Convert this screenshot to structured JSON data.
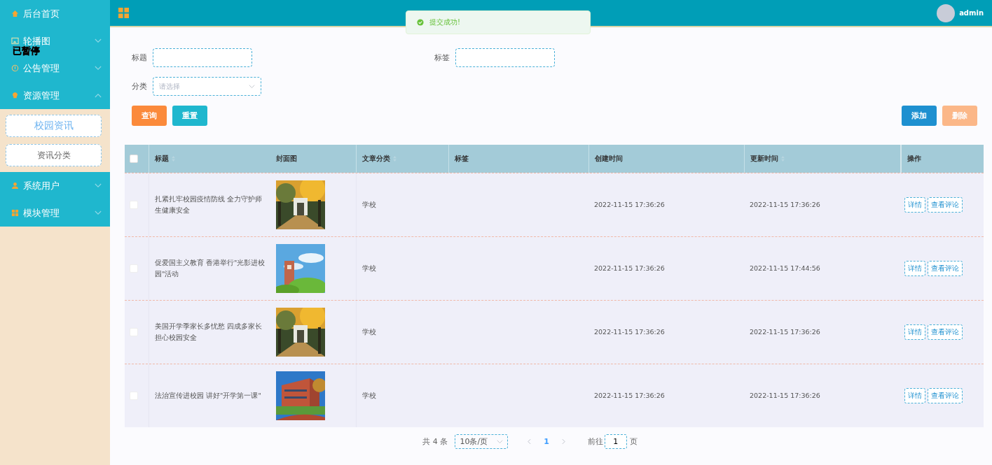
{
  "sidebar": {
    "items": [
      {
        "label": "后台首页",
        "kind": "link"
      },
      {
        "label": "轮播图",
        "kind": "menu",
        "expanded": false
      },
      {
        "label": "公告管理",
        "kind": "menu",
        "expanded": false
      },
      {
        "label": "资源管理",
        "kind": "menu",
        "expanded": true,
        "children": [
          {
            "label": "校园资讯",
            "selected": true
          },
          {
            "label": "资讯分类",
            "selected": false
          }
        ]
      },
      {
        "label": "系统用户",
        "kind": "menu",
        "expanded": false
      },
      {
        "label": "模块管理",
        "kind": "menu",
        "expanded": false
      }
    ]
  },
  "overlay_text": "已暂停",
  "header": {
    "user": "admin"
  },
  "toast": {
    "kind": "success",
    "text": "提交成功!"
  },
  "filters": [
    {
      "label": "标题",
      "kind": "input"
    },
    {
      "label": "标签",
      "kind": "input"
    },
    {
      "label": "分类",
      "kind": "select",
      "placeholder": "请选择"
    }
  ],
  "buttons": [
    {
      "label": "查询",
      "kind": "search",
      "disabled": false
    },
    {
      "label": "重置",
      "kind": "reset",
      "disabled": false
    },
    {
      "label": "添加",
      "kind": "add",
      "disabled": false
    },
    {
      "label": "删除",
      "kind": "delete",
      "disabled": true
    }
  ],
  "table": {
    "select_all": {
      "checked": false
    },
    "columns": [
      {
        "label": "标题",
        "sortable": true
      },
      {
        "label": "封面图",
        "sortable": false
      },
      {
        "label": "文章分类",
        "sortable": true
      },
      {
        "label": "标签",
        "sortable": false
      },
      {
        "label": "创建时间",
        "sortable": false
      },
      {
        "label": "更新时间",
        "sortable": true
      },
      {
        "label": "操作",
        "sortable": false
      }
    ],
    "rows": [
      {
        "checked": false,
        "title": "扎紧扎牢校园疫情防线 全力守护师生健康安全",
        "cover": {
          "kind": "picture"
        },
        "category": "学校",
        "created": "2022-11-15 17:36:26",
        "updated": "2022-11-15 17:36:26",
        "actions": [
          "详情",
          "查看评论"
        ]
      },
      {
        "checked": false,
        "title": "促爱国主义教育 香港举行\"光影进校园\"活动",
        "cover": {
          "kind": "picture"
        },
        "category": "学校",
        "created": "2022-11-15 17:36:26",
        "updated": "2022-11-15 17:44:56",
        "actions": [
          "详情",
          "查看评论"
        ]
      },
      {
        "checked": false,
        "title": "美国开学季家长多忧愁 四成多家长担心校园安全",
        "cover": {
          "kind": "picture"
        },
        "category": "学校",
        "created": "2022-11-15 17:36:26",
        "updated": "2022-11-15 17:36:26",
        "actions": [
          "详情",
          "查看评论"
        ]
      },
      {
        "checked": false,
        "title": "法治宣传进校园 讲好\"开学第一课\"",
        "cover": {
          "kind": "picture"
        },
        "category": "学校",
        "created": "2022-11-15 17:36:26",
        "updated": "2022-11-15 17:36:26",
        "actions": [
          "详情",
          "查看评论"
        ]
      }
    ]
  },
  "pagination": {
    "total": "共 4 条",
    "page_size": "10条/页",
    "pages": [
      {
        "label": "1",
        "selected": true
      }
    ],
    "goto_label": "前往",
    "goto_value": "1",
    "goto_suffix": "页"
  }
}
